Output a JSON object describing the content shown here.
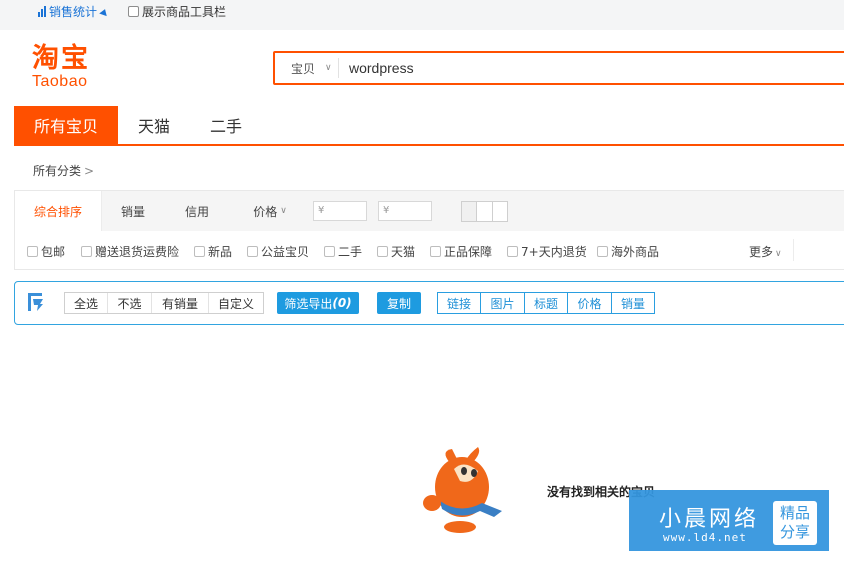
{
  "topbar": {
    "sales_stat": "销售统计",
    "show_toolbar": "展示商品工具栏"
  },
  "logo": {
    "cn": "淘宝",
    "en": "Taobao"
  },
  "search": {
    "scope": "宝贝",
    "value": "wordpress"
  },
  "tabs": [
    "所有宝贝",
    "天猫",
    "二手"
  ],
  "breadcrumb": {
    "label": "所有分类"
  },
  "sort": {
    "items": [
      "综合排序",
      "销量",
      "信用",
      "价格"
    ],
    "price_min_placeholder": "¥",
    "price_max_placeholder": "¥",
    "dash": "-"
  },
  "options": [
    "包邮",
    "赠送退货运费险",
    "新品",
    "公益宝贝",
    "二手",
    "天猫",
    "正品保障",
    "7+天内退货",
    "海外商品"
  ],
  "more": "更多",
  "plugin": {
    "select_group": [
      "全选",
      "不选",
      "有销量",
      "自定义"
    ],
    "export_label": "筛选导出",
    "export_count": "(0)",
    "copy_label": "复制",
    "fields": [
      "链接",
      "图片",
      "标题",
      "价格",
      "销量"
    ]
  },
  "empty_message": "没有找到相关的宝贝",
  "watermark": {
    "name": "小晨网络",
    "url": "www.ld4.net",
    "badge_line1": "精品",
    "badge_line2": "分享"
  },
  "colors": {
    "accent": "#ff5000",
    "plugin_blue": "#1e9be0",
    "link_blue": "#1a73d6"
  }
}
